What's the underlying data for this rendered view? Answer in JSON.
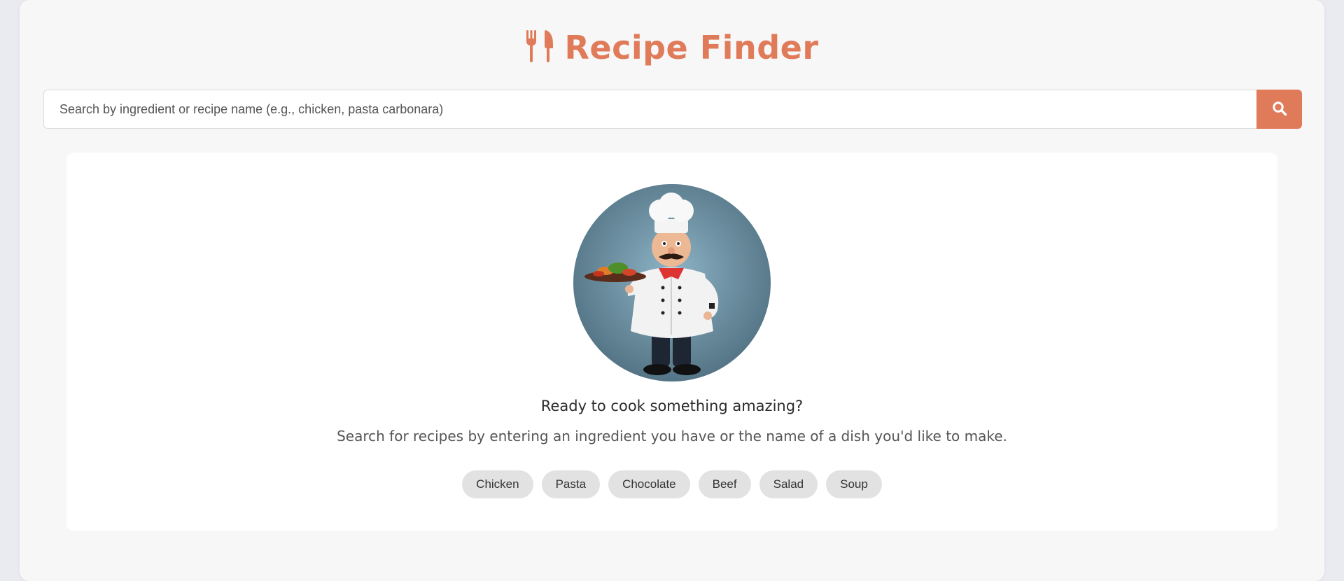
{
  "app": {
    "title": "Recipe Finder",
    "logo_icon": "utensils-icon",
    "accent_color": "#e07b5a"
  },
  "search": {
    "placeholder": "Search by ingredient or recipe name (e.g., chicken, pasta carbonara)",
    "value": "",
    "button_icon": "search-icon"
  },
  "welcome": {
    "illustration": "chef-illustration",
    "heading": "Ready to cook something amazing?",
    "text": "Search for recipes by entering an ingredient you have or the name of a dish you'd like to make.",
    "suggestions": [
      "Chicken",
      "Pasta",
      "Chocolate",
      "Beef",
      "Salad",
      "Soup"
    ]
  }
}
